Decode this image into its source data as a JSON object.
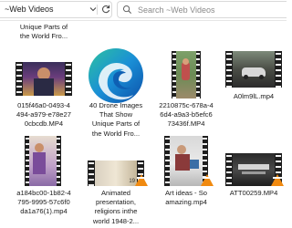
{
  "toolbar": {
    "breadcrumb": "~Web Videos",
    "search_placeholder": "Search ~Web Videos"
  },
  "icons": {
    "chevron": "chevron-down-icon",
    "refresh": "refresh-icon",
    "search": "search-icon",
    "edge": "microsoft-edge-icon",
    "vlc": "vlc-cone-icon"
  },
  "colors": {
    "accent_vlc": "#f08a10",
    "edge_blue": "#1b6ec2",
    "edge_green": "#36c39a"
  },
  "files": {
    "top_label": "Unique Parts of\nthe World Fro...",
    "row1": [
      {
        "name": "015f46a0-0493-4\n494-a979-e78e27\n0cbcdb.MP4"
      },
      {
        "name": "40 Drone Images\nThat Show\nUnique Parts of\nthe World Fro..."
      },
      {
        "name": "2210875c-678a-4\n6d4-a9a3-b5efc6\n73436f.MP4"
      },
      {
        "name": "A0lm9lL.mp4"
      }
    ],
    "row2": [
      {
        "name": "a184bc00-1b82-4\n795-9995-57c6f0\nda1a76(1).mp4"
      },
      {
        "name": "Animated\npresentation,\nreligions inthe\nworld 1948-2..."
      },
      {
        "name": "Art ideas - So\namazing.mp4"
      },
      {
        "name": "ATT00259.MP4"
      }
    ]
  }
}
